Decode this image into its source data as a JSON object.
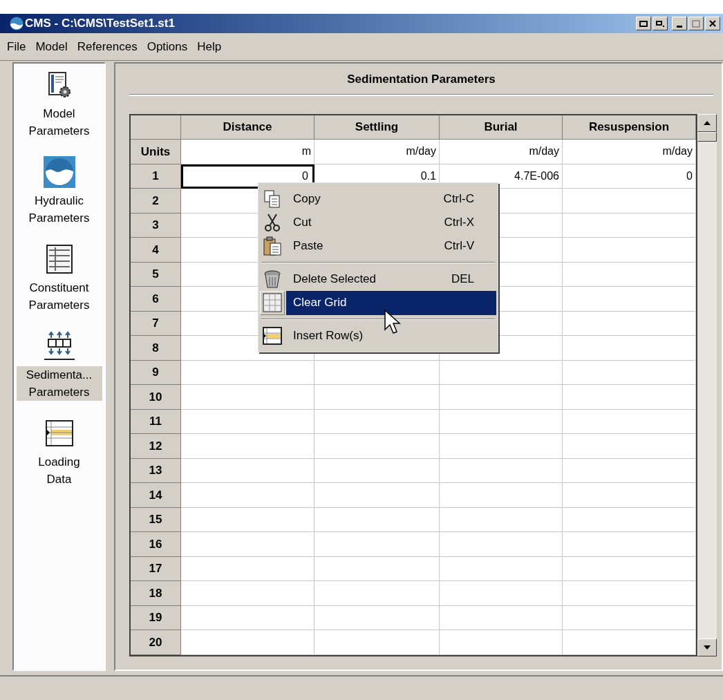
{
  "window": {
    "title": "CMS - C:\\CMS\\TestSet1.st1"
  },
  "menu_bar": [
    "File",
    "Model",
    "References",
    "Options",
    "Help"
  ],
  "sidebar": {
    "items": [
      {
        "kind": "document-gear",
        "label": [
          "Model",
          "Parameters"
        ],
        "selected": false
      },
      {
        "kind": "water",
        "label": [
          "Hydraulic",
          "Parameters"
        ],
        "selected": false
      },
      {
        "kind": "sheet",
        "label": [
          "Constituent",
          "Parameters"
        ],
        "selected": false
      },
      {
        "kind": "layers",
        "label": [
          "Sedimenta...",
          "Parameters"
        ],
        "selected": true
      },
      {
        "kind": "table",
        "label": [
          "Loading",
          "Data"
        ],
        "selected": false
      }
    ]
  },
  "panel": {
    "title": "Sedimentation Parameters",
    "table": {
      "columns": [
        "Distance",
        "Settling",
        "Burial",
        "Resuspension"
      ],
      "units": {
        "label": "Units",
        "values": [
          "m",
          "m/day",
          "m/day",
          "m/day"
        ]
      },
      "rows": [
        {
          "label": "1",
          "cells": [
            {
              "text": "0",
              "selected": true
            },
            {
              "text": "0.1",
              "selected": false
            },
            {
              "text": "4.7E-006",
              "selected": false
            },
            {
              "text": "0",
              "selected": false
            }
          ]
        },
        {
          "label": "2"
        },
        {
          "label": "3"
        },
        {
          "label": "4"
        },
        {
          "label": "5"
        },
        {
          "label": "6"
        },
        {
          "label": "7"
        },
        {
          "label": "8"
        },
        {
          "label": "9"
        },
        {
          "label": "10"
        },
        {
          "label": "11"
        },
        {
          "label": "12"
        },
        {
          "label": "13"
        },
        {
          "label": "14"
        },
        {
          "label": "15"
        },
        {
          "label": "16"
        },
        {
          "label": "17"
        },
        {
          "label": "18"
        },
        {
          "label": "19"
        },
        {
          "label": "20"
        }
      ]
    }
  },
  "context_menu": {
    "items": [
      {
        "kind": "item",
        "label": "Copy",
        "shortcut": "Ctrl-C",
        "selected": false
      },
      {
        "kind": "item",
        "label": "Cut",
        "shortcut": "Ctrl-X",
        "selected": false
      },
      {
        "kind": "item",
        "label": "Paste",
        "shortcut": "Ctrl-V",
        "selected": false
      },
      {
        "kind": "separator"
      },
      {
        "kind": "item",
        "label": "Delete Selected",
        "shortcut": "DEL",
        "selected": false
      },
      {
        "kind": "item",
        "label": "Clear Grid",
        "selected": true
      },
      {
        "kind": "separator"
      },
      {
        "kind": "item",
        "label": "Insert Row(s)",
        "selected": false
      }
    ]
  }
}
